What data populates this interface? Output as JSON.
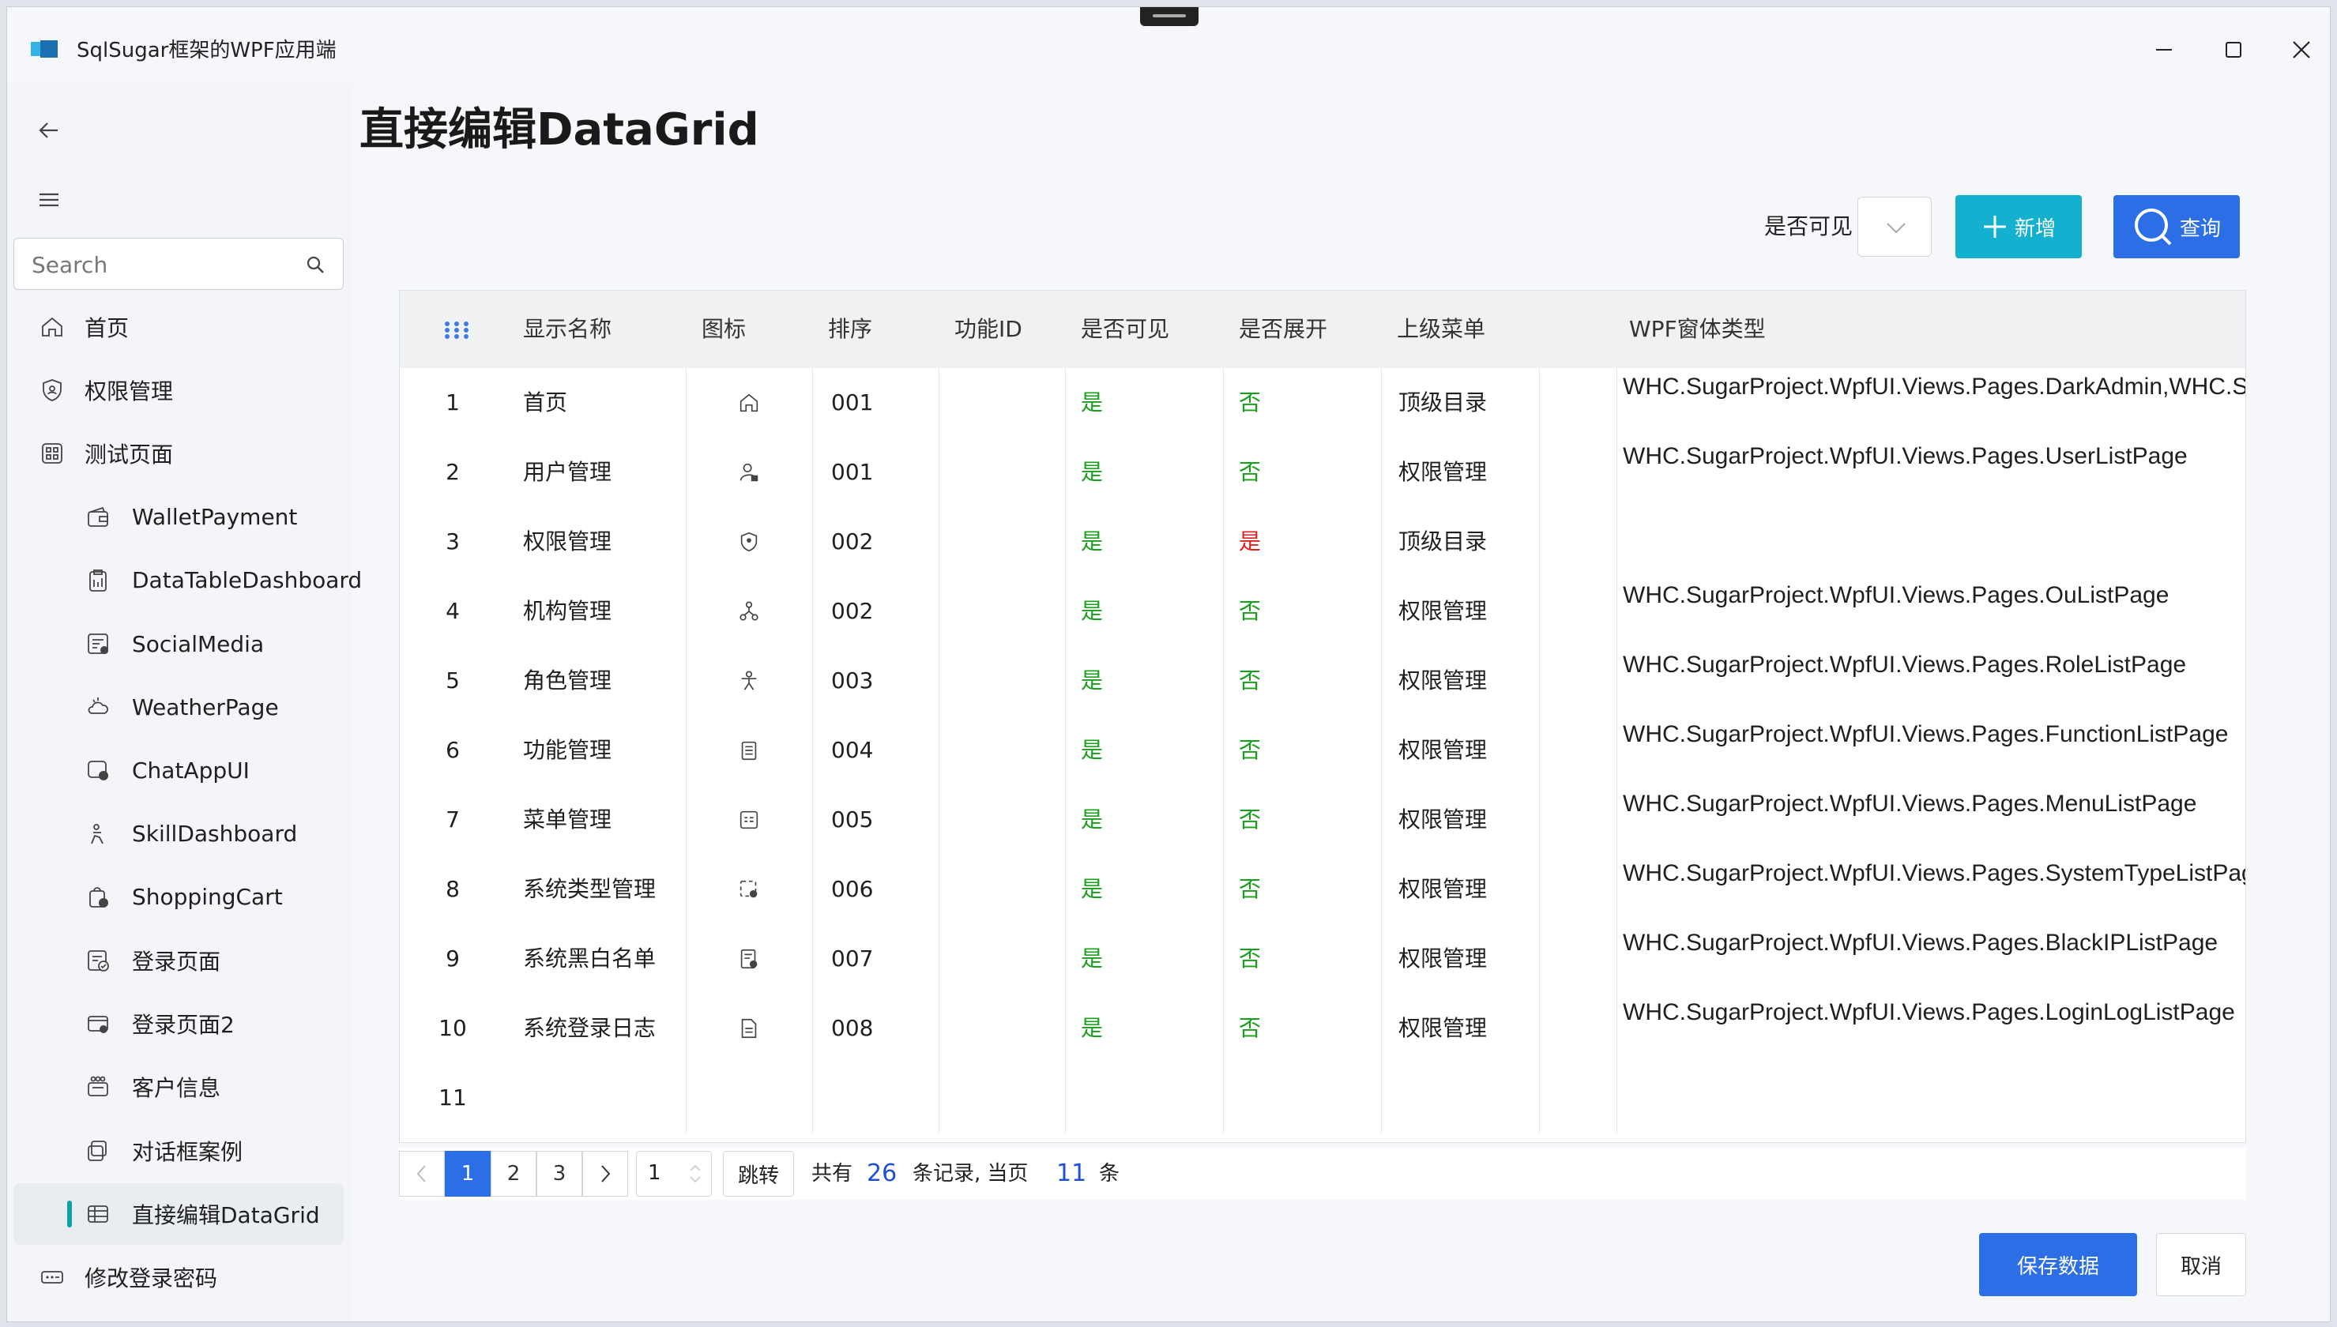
{
  "window": {
    "title": "SqlSugar框架的WPF应用端"
  },
  "sidebar": {
    "search_placeholder": "Search",
    "items": [
      {
        "label": "首页",
        "icon": "home-icon",
        "level": "top"
      },
      {
        "label": "权限管理",
        "icon": "shield-icon",
        "level": "top"
      },
      {
        "label": "测试页面",
        "icon": "grid-icon",
        "level": "top"
      },
      {
        "label": "WalletPayment",
        "icon": "wallet-icon",
        "level": "sub"
      },
      {
        "label": "DataTableDashboard",
        "icon": "clipboard-icon",
        "level": "sub"
      },
      {
        "label": "SocialMedia",
        "icon": "social-icon",
        "level": "sub"
      },
      {
        "label": "WeatherPage",
        "icon": "weather-icon",
        "level": "sub"
      },
      {
        "label": "ChatAppUI",
        "icon": "chat-icon",
        "level": "sub"
      },
      {
        "label": "SkillDashboard",
        "icon": "skill-icon",
        "level": "sub"
      },
      {
        "label": "ShoppingCart",
        "icon": "cart-icon",
        "level": "sub"
      },
      {
        "label": "登录页面",
        "icon": "login-icon",
        "level": "sub"
      },
      {
        "label": "登录页面2",
        "icon": "login2-icon",
        "level": "sub"
      },
      {
        "label": "客户信息",
        "icon": "people-icon",
        "level": "sub"
      },
      {
        "label": "对话框案例",
        "icon": "dialog-icon",
        "level": "sub"
      },
      {
        "label": "直接编辑DataGrid",
        "icon": "table-icon",
        "level": "sub",
        "active": true
      },
      {
        "label": "修改登录密码",
        "icon": "password-icon",
        "level": "top"
      }
    ]
  },
  "page": {
    "title": "直接编辑DataGrid"
  },
  "toolbar": {
    "visible_label": "是否可见",
    "visible_value": "",
    "add_label": "新增",
    "query_label": "查询"
  },
  "grid": {
    "columns": [
      "显示名称",
      "图标",
      "排序",
      "功能ID",
      "是否可见",
      "是否展开",
      "上级菜单",
      "WPF窗体类型"
    ],
    "rows": [
      {
        "no": "1",
        "name": "首页",
        "icon": "home",
        "sort": "001",
        "fid": "",
        "visible": "是",
        "expand": "否",
        "parent": "顶级目录",
        "wpf": "WHC.SugarProject.WpfUI.Views.Pages.DarkAdmin,WHC.SugarProject.WpfUI"
      },
      {
        "no": "2",
        "name": "用户管理",
        "icon": "user-lock",
        "sort": "001",
        "fid": "",
        "visible": "是",
        "expand": "否",
        "parent": "权限管理",
        "wpf": "WHC.SugarProject.WpfUI.Views.Pages.UserListPage"
      },
      {
        "no": "3",
        "name": "权限管理",
        "icon": "shield",
        "sort": "002",
        "fid": "",
        "visible": "是",
        "expand": "是",
        "parent": "顶级目录",
        "wpf": ""
      },
      {
        "no": "4",
        "name": "机构管理",
        "icon": "org",
        "sort": "002",
        "fid": "",
        "visible": "是",
        "expand": "否",
        "parent": "权限管理",
        "wpf": "WHC.SugarProject.WpfUI.Views.Pages.OuListPage"
      },
      {
        "no": "5",
        "name": "角色管理",
        "icon": "role",
        "sort": "003",
        "fid": "",
        "visible": "是",
        "expand": "否",
        "parent": "权限管理",
        "wpf": "WHC.SugarProject.WpfUI.Views.Pages.RoleListPage"
      },
      {
        "no": "6",
        "name": "功能管理",
        "icon": "function",
        "sort": "004",
        "fid": "",
        "visible": "是",
        "expand": "否",
        "parent": "权限管理",
        "wpf": "WHC.SugarProject.WpfUI.Views.Pages.FunctionListPage"
      },
      {
        "no": "7",
        "name": "菜单管理",
        "icon": "menu",
        "sort": "005",
        "fid": "",
        "visible": "是",
        "expand": "否",
        "parent": "权限管理",
        "wpf": "WHC.SugarProject.WpfUI.Views.Pages.MenuListPage"
      },
      {
        "no": "8",
        "name": "系统类型管理",
        "icon": "systype",
        "sort": "006",
        "fid": "",
        "visible": "是",
        "expand": "否",
        "parent": "权限管理",
        "wpf": "WHC.SugarProject.WpfUI.Views.Pages.SystemTypeListPage"
      },
      {
        "no": "9",
        "name": "系统黑白名单",
        "icon": "blacklist",
        "sort": "007",
        "fid": "",
        "visible": "是",
        "expand": "否",
        "parent": "权限管理",
        "wpf": "WHC.SugarProject.WpfUI.Views.Pages.BlackIPListPage"
      },
      {
        "no": "10",
        "name": "系统登录日志",
        "icon": "log",
        "sort": "008",
        "fid": "",
        "visible": "是",
        "expand": "否",
        "parent": "权限管理",
        "wpf": "WHC.SugarProject.WpfUI.Views.Pages.LoginLogListPage"
      },
      {
        "no": "11",
        "name": "",
        "icon": "",
        "sort": "",
        "fid": "",
        "visible": "",
        "expand": "",
        "parent": "",
        "wpf": ""
      }
    ]
  },
  "pager": {
    "pages": [
      "1",
      "2",
      "3"
    ],
    "current": "1",
    "goto_value": "1",
    "jump_label": "跳转",
    "total_prefix": "共有",
    "total": "26",
    "total_mid": "条记录, 当页",
    "page_count": "11",
    "total_suffix": "条"
  },
  "footer": {
    "save_label": "保存数据",
    "cancel_label": "取消"
  },
  "colors": {
    "accent": "#2b6ee6",
    "add": "#13b0cf",
    "yes": "#18a01c",
    "no_red": "#e02020",
    "active_bar": "#0aa3a3"
  }
}
